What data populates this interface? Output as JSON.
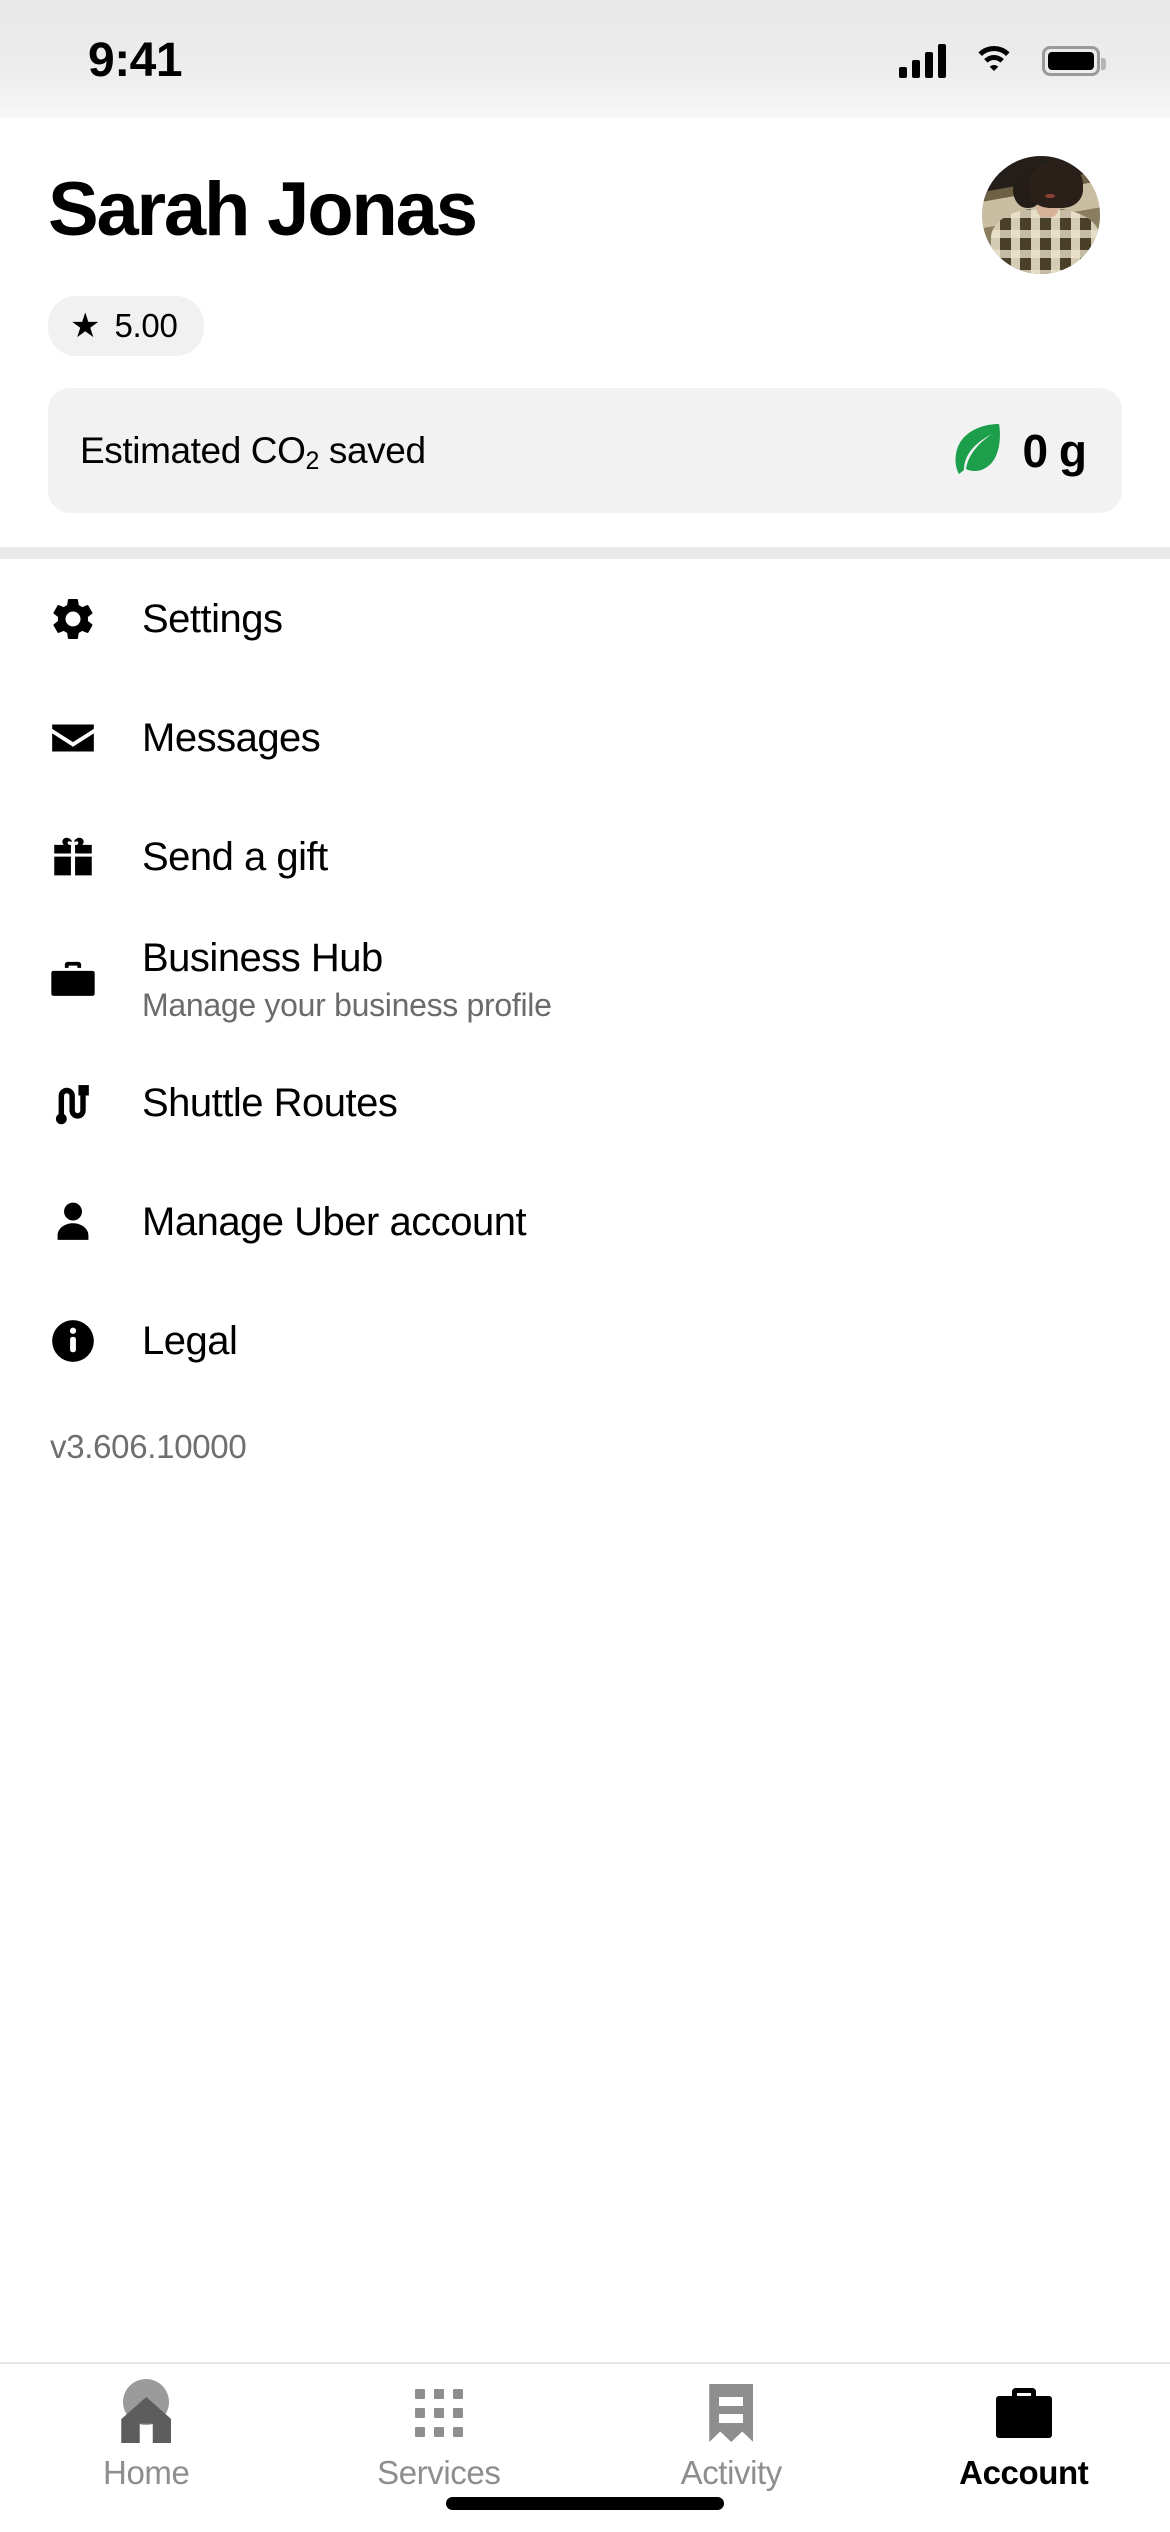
{
  "status_bar": {
    "time": "9:41",
    "icons": [
      "cellular-signal-icon",
      "wifi-icon",
      "battery-icon"
    ]
  },
  "header": {
    "name": "Sarah Jonas",
    "avatar_alt": "profile-photo",
    "rating": {
      "star": "★",
      "value": "5.00"
    }
  },
  "co2_card": {
    "label_prefix": "Estimated CO",
    "label_sub": "2",
    "label_suffix": " saved",
    "icon": "leaf-icon",
    "value": "0 g",
    "leaf_color": "#1d9e4b",
    "background": "#f2f2f3"
  },
  "menu": {
    "items": [
      {
        "icon": "gear-icon",
        "label": "Settings",
        "sub": ""
      },
      {
        "icon": "envelope-icon",
        "label": "Messages",
        "sub": ""
      },
      {
        "icon": "gift-icon",
        "label": "Send a gift",
        "sub": ""
      },
      {
        "icon": "briefcase-icon",
        "label": "Business Hub",
        "sub": "Manage your business profile"
      },
      {
        "icon": "route-icon",
        "label": "Shuttle Routes",
        "sub": ""
      },
      {
        "icon": "person-icon",
        "label": "Manage Uber account",
        "sub": ""
      },
      {
        "icon": "info-icon",
        "label": "Legal",
        "sub": ""
      }
    ],
    "version": "v3.606.10000"
  },
  "tab_bar": {
    "tabs": [
      {
        "label": "Home",
        "icon": "home-person-icon",
        "active": false
      },
      {
        "label": "Services",
        "icon": "grid-icon",
        "active": false
      },
      {
        "label": "Activity",
        "icon": "receipt-icon",
        "active": false
      },
      {
        "label": "Account",
        "icon": "briefcase-icon",
        "active": true
      }
    ]
  }
}
